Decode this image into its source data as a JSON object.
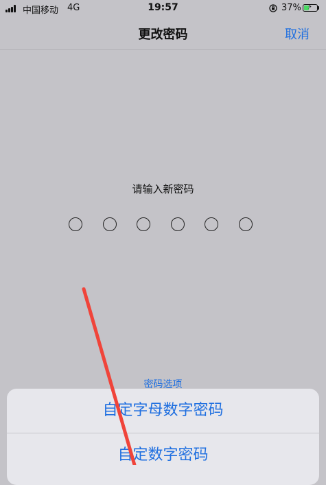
{
  "status_bar": {
    "carrier": "中国移动",
    "network": "4G",
    "time": "19:57",
    "battery_percent": "37%",
    "battery_level": 0.37,
    "icons": [
      "signal-icon",
      "orientation-lock-icon",
      "battery-charging-icon"
    ]
  },
  "nav": {
    "title": "更改密码",
    "cancel_label": "取消"
  },
  "passcode": {
    "prompt": "请输入新密码",
    "digit_count": 6,
    "entered_count": 0
  },
  "options": {
    "link_label": "密码选项",
    "items": [
      {
        "label": "自定字母数字密码"
      },
      {
        "label": "自定数字密码"
      }
    ]
  },
  "colors": {
    "accent": "#1f6fe0",
    "background": "#c4c3c8",
    "annotation": "#f0443a"
  }
}
